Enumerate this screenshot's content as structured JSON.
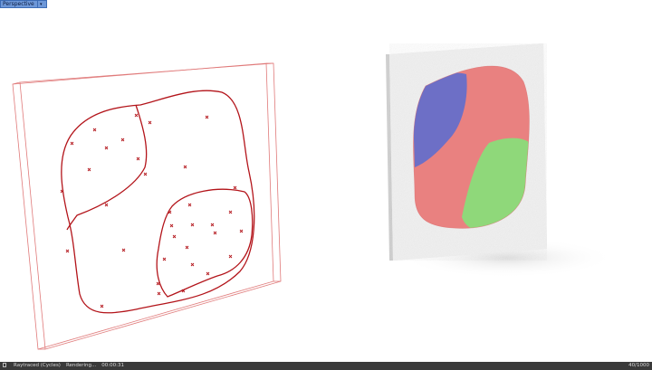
{
  "viewport": {
    "name": "Perspective",
    "menu_icon": "triangle-down-icon"
  },
  "status": {
    "stop_icon": "stop-icon",
    "renderer": "Raytraced (Cycles)",
    "state": "Rendering...",
    "time": "00:00:31",
    "samples": "40/1000"
  },
  "colors": {
    "curve": "#b3141a",
    "frame": "#e07a7a",
    "region_blue": "#6d6fc6",
    "region_red": "#e98180",
    "region_green": "#8fd87a",
    "panel": "#f0f0f0",
    "tab_bg": "#6e98d8",
    "status_bg": "#3a3a3a"
  }
}
